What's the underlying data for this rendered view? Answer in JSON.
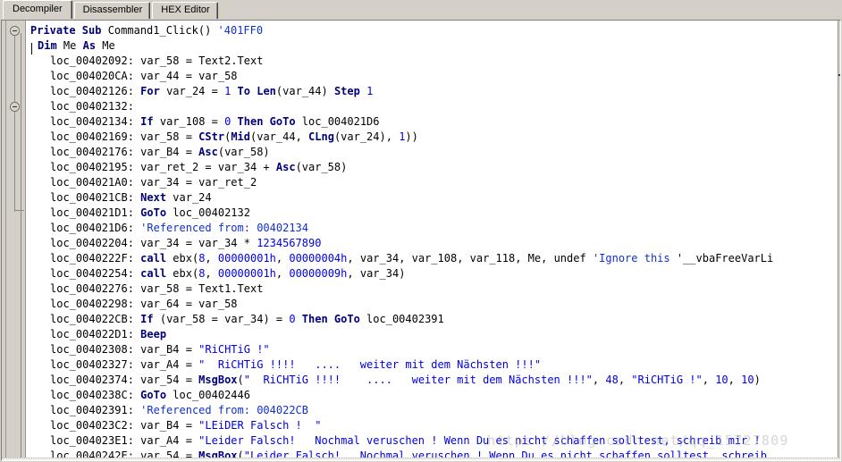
{
  "window": {
    "tabs": [
      {
        "label": "Decompiler",
        "active": true
      },
      {
        "label": "Disassembler",
        "active": false
      },
      {
        "label": "HEX Editor",
        "active": false
      }
    ]
  },
  "watermark": {
    "text": "https://blog.csdn.net/qq_15727809"
  },
  "colors": {
    "keyword": "#00007a",
    "literal": "#0000e0",
    "comment": "#1030d0",
    "identifier": "#000000",
    "background": "#ffffff",
    "chrome": "#d4d0c8"
  },
  "code": {
    "language": "Visual Basic (decompiled)",
    "lines": [
      {
        "indent": 0,
        "tokens": [
          {
            "t": "Private Sub ",
            "c": "kw"
          },
          {
            "t": "Command1_Click() ",
            "c": "id"
          },
          {
            "t": "'401FF0",
            "c": "cm"
          }
        ]
      },
      {
        "indent": 1,
        "tokens": [
          {
            "t": "Dim ",
            "c": "kw"
          },
          {
            "t": "Me ",
            "c": "id"
          },
          {
            "t": "As ",
            "c": "kw"
          },
          {
            "t": "Me",
            "c": "id"
          }
        ]
      },
      {
        "indent": 2,
        "tokens": [
          {
            "t": "loc_00402092: var_58 = Text2.Text",
            "c": "id"
          }
        ]
      },
      {
        "indent": 2,
        "tokens": [
          {
            "t": "loc_004020CA: var_44 = var_58",
            "c": "id"
          }
        ]
      },
      {
        "indent": 2,
        "tokens": [
          {
            "t": "loc_00402126: ",
            "c": "id"
          },
          {
            "t": "For ",
            "c": "kw"
          },
          {
            "t": "var_24 = ",
            "c": "id"
          },
          {
            "t": "1 ",
            "c": "lit"
          },
          {
            "t": "To ",
            "c": "kw"
          },
          {
            "t": "Len",
            "c": "kw"
          },
          {
            "t": "(var_44) ",
            "c": "id"
          },
          {
            "t": "Step ",
            "c": "kw"
          },
          {
            "t": "1",
            "c": "lit"
          }
        ]
      },
      {
        "indent": 2,
        "tokens": [
          {
            "t": "loc_00402132:",
            "c": "id"
          }
        ]
      },
      {
        "indent": 2,
        "tokens": [
          {
            "t": "loc_00402134: ",
            "c": "id"
          },
          {
            "t": "If ",
            "c": "kw"
          },
          {
            "t": "var_108 = ",
            "c": "id"
          },
          {
            "t": "0 ",
            "c": "lit"
          },
          {
            "t": "Then GoTo ",
            "c": "kw"
          },
          {
            "t": "loc_004021D6",
            "c": "id"
          }
        ]
      },
      {
        "indent": 2,
        "tokens": [
          {
            "t": "loc_00402169: var_58 = ",
            "c": "id"
          },
          {
            "t": "CStr",
            "c": "kw"
          },
          {
            "t": "(",
            "c": "id"
          },
          {
            "t": "Mid",
            "c": "kw"
          },
          {
            "t": "(var_44, ",
            "c": "id"
          },
          {
            "t": "CLng",
            "c": "kw"
          },
          {
            "t": "(var_24), ",
            "c": "id"
          },
          {
            "t": "1",
            "c": "lit"
          },
          {
            "t": "))",
            "c": "id"
          }
        ]
      },
      {
        "indent": 2,
        "tokens": [
          {
            "t": "loc_00402176: var_B4 = ",
            "c": "id"
          },
          {
            "t": "Asc",
            "c": "kw"
          },
          {
            "t": "(var_58)",
            "c": "id"
          }
        ]
      },
      {
        "indent": 2,
        "tokens": [
          {
            "t": "loc_00402195: var_ret_2 = var_34 + ",
            "c": "id"
          },
          {
            "t": "Asc",
            "c": "kw"
          },
          {
            "t": "(var_58)",
            "c": "id"
          }
        ]
      },
      {
        "indent": 2,
        "tokens": [
          {
            "t": "loc_004021A0: var_34 = var_ret_2",
            "c": "id"
          }
        ]
      },
      {
        "indent": 2,
        "tokens": [
          {
            "t": "loc_004021CB: ",
            "c": "id"
          },
          {
            "t": "Next ",
            "c": "kw"
          },
          {
            "t": "var_24",
            "c": "id"
          }
        ]
      },
      {
        "indent": 2,
        "tokens": [
          {
            "t": "loc_004021D1: ",
            "c": "id"
          },
          {
            "t": "GoTo ",
            "c": "kw"
          },
          {
            "t": "loc_00402132",
            "c": "id"
          }
        ]
      },
      {
        "indent": 2,
        "tokens": [
          {
            "t": "loc_004021D6: ",
            "c": "id"
          },
          {
            "t": "'Referenced from: 00402134",
            "c": "cm"
          }
        ]
      },
      {
        "indent": 2,
        "tokens": [
          {
            "t": "loc_00402204: var_34 = var_34 * ",
            "c": "id"
          },
          {
            "t": "1234567890",
            "c": "lit"
          }
        ]
      },
      {
        "indent": 2,
        "tokens": [
          {
            "t": "loc_0040222F: ",
            "c": "id"
          },
          {
            "t": "call ",
            "c": "kw"
          },
          {
            "t": "ebx(",
            "c": "id"
          },
          {
            "t": "8",
            "c": "lit"
          },
          {
            "t": ", ",
            "c": "id"
          },
          {
            "t": "00000001h",
            "c": "lit"
          },
          {
            "t": ", ",
            "c": "id"
          },
          {
            "t": "00000004h",
            "c": "lit"
          },
          {
            "t": ", var_34, var_108, var_118, Me, undef ",
            "c": "id"
          },
          {
            "t": "'Ignore this ",
            "c": "cm"
          },
          {
            "t": "'__vbaFreeVarLi",
            "c": "id"
          }
        ]
      },
      {
        "indent": 2,
        "tokens": [
          {
            "t": "loc_00402254: ",
            "c": "id"
          },
          {
            "t": "call ",
            "c": "kw"
          },
          {
            "t": "ebx(",
            "c": "id"
          },
          {
            "t": "8",
            "c": "lit"
          },
          {
            "t": ", ",
            "c": "id"
          },
          {
            "t": "00000001h",
            "c": "lit"
          },
          {
            "t": ", ",
            "c": "id"
          },
          {
            "t": "00000009h",
            "c": "lit"
          },
          {
            "t": ", var_34)",
            "c": "id"
          }
        ]
      },
      {
        "indent": 2,
        "tokens": [
          {
            "t": "loc_00402276: var_58 = Text1.Text",
            "c": "id"
          }
        ]
      },
      {
        "indent": 2,
        "tokens": [
          {
            "t": "loc_00402298: var_64 = var_58",
            "c": "id"
          }
        ]
      },
      {
        "indent": 2,
        "tokens": [
          {
            "t": "loc_004022CB: ",
            "c": "id"
          },
          {
            "t": "If ",
            "c": "kw"
          },
          {
            "t": "(var_58 = var_34) = ",
            "c": "id"
          },
          {
            "t": "0 ",
            "c": "lit"
          },
          {
            "t": "Then GoTo ",
            "c": "kw"
          },
          {
            "t": "loc_00402391",
            "c": "id"
          }
        ]
      },
      {
        "indent": 2,
        "tokens": [
          {
            "t": "loc_004022D1: ",
            "c": "id"
          },
          {
            "t": "Beep",
            "c": "kw"
          }
        ]
      },
      {
        "indent": 2,
        "tokens": [
          {
            "t": "loc_00402308: var_B4 = ",
            "c": "id"
          },
          {
            "t": "\"RiCHTiG !\"",
            "c": "str"
          }
        ]
      },
      {
        "indent": 2,
        "tokens": [
          {
            "t": "loc_00402327: var_A4 = ",
            "c": "id"
          },
          {
            "t": "\"  RiCHTiG !!!!   ....   weiter mit dem Nächsten !!!\"",
            "c": "str"
          }
        ]
      },
      {
        "indent": 2,
        "tokens": [
          {
            "t": "loc_00402374: var_54 = ",
            "c": "id"
          },
          {
            "t": "MsgBox",
            "c": "kw"
          },
          {
            "t": "(",
            "c": "id"
          },
          {
            "t": "\"  RiCHTiG !!!!    ....   weiter mit dem Nächsten !!!\"",
            "c": "str"
          },
          {
            "t": ", ",
            "c": "id"
          },
          {
            "t": "48",
            "c": "lit"
          },
          {
            "t": ", ",
            "c": "id"
          },
          {
            "t": "\"RiCHTiG !\"",
            "c": "str"
          },
          {
            "t": ", ",
            "c": "id"
          },
          {
            "t": "10",
            "c": "lit"
          },
          {
            "t": ", ",
            "c": "id"
          },
          {
            "t": "10",
            "c": "lit"
          },
          {
            "t": ")",
            "c": "id"
          }
        ]
      },
      {
        "indent": 2,
        "tokens": [
          {
            "t": "loc_0040238C: ",
            "c": "id"
          },
          {
            "t": "GoTo ",
            "c": "kw"
          },
          {
            "t": "loc_00402446",
            "c": "id"
          }
        ]
      },
      {
        "indent": 2,
        "tokens": [
          {
            "t": "loc_00402391: ",
            "c": "id"
          },
          {
            "t": "'Referenced from: 004022CB",
            "c": "cm"
          }
        ]
      },
      {
        "indent": 2,
        "tokens": [
          {
            "t": "loc_004023C2: var_B4 = ",
            "c": "id"
          },
          {
            "t": "\"LEiDER Falsch !  \"",
            "c": "str"
          }
        ]
      },
      {
        "indent": 2,
        "tokens": [
          {
            "t": "loc_004023E1: var_A4 = ",
            "c": "id"
          },
          {
            "t": "\"Leider Falsch!   Nochmal veruschen ! Wenn Du es nicht schaffen solltest, schreib mir !",
            "c": "str"
          }
        ]
      },
      {
        "indent": 2,
        "tokens": [
          {
            "t": "loc_0040242E: var_54 = ",
            "c": "id"
          },
          {
            "t": "MsgBox",
            "c": "kw"
          },
          {
            "t": "(",
            "c": "id"
          },
          {
            "t": "\"Leider Falsch!   Nochmal veruschen ! Wenn Du es nicht schaffen solltest, schreib ",
            "c": "str"
          }
        ]
      }
    ]
  }
}
